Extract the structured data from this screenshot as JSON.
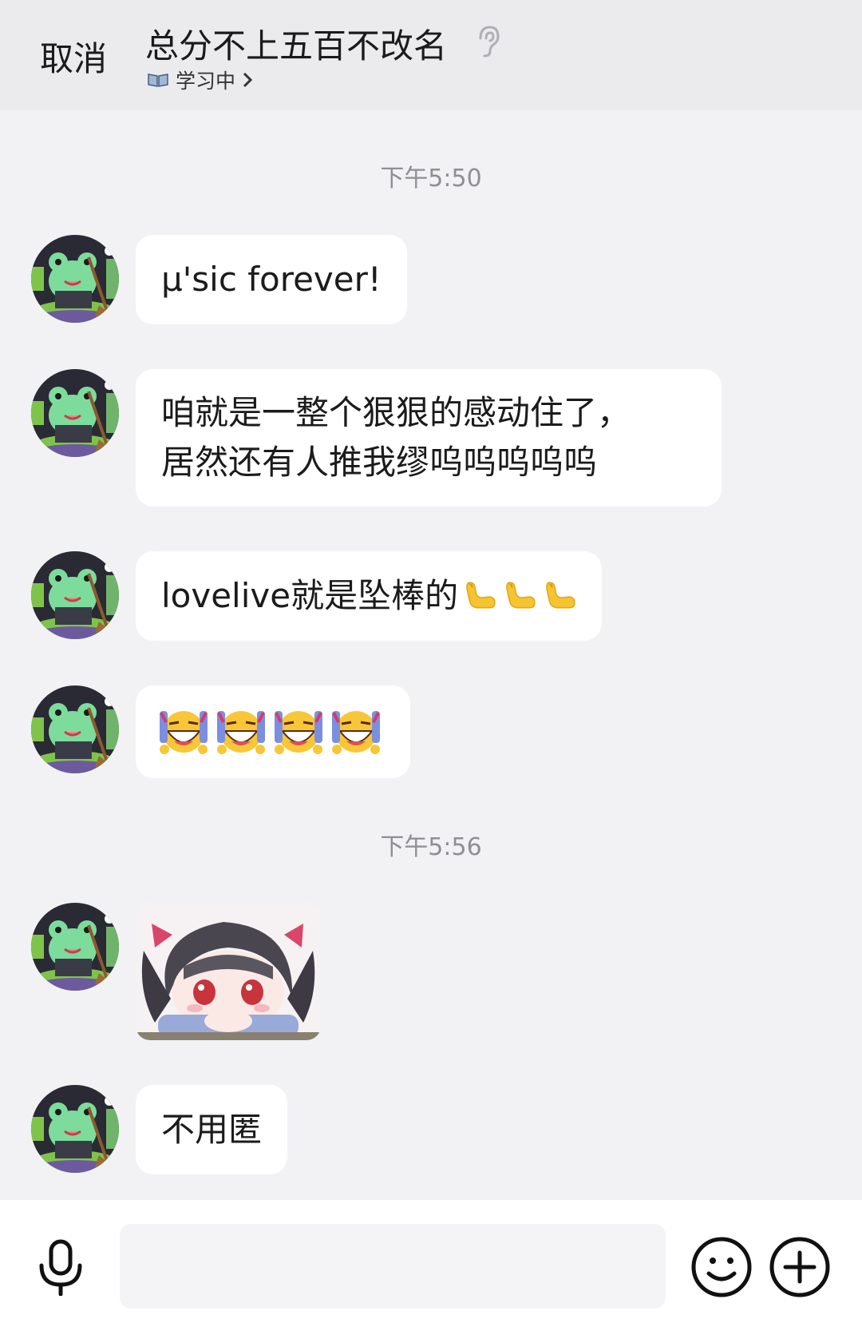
{
  "header": {
    "cancel_label": "取消",
    "title": "总分不上五百不改名",
    "status": "学习中"
  },
  "timestamps": [
    "下午5:50",
    "下午5:56"
  ],
  "messages": [
    {
      "type": "text",
      "text": "μ'sic forever!"
    },
    {
      "type": "text",
      "lines": [
        "咱就是一整个狠狠的感动住了，",
        "居然还有人推我缪呜呜呜呜呜"
      ]
    },
    {
      "type": "text",
      "text": "lovelive就是坠棒的",
      "emoji": "flexed-biceps",
      "emoji_count": 3
    },
    {
      "type": "emoji",
      "emoji": "rolling-laughing",
      "emoji_count": 4
    },
    {
      "type": "sticker",
      "description_icon": "anime-girl-sticker"
    },
    {
      "type": "text",
      "text": "不用匿"
    }
  ],
  "input": {
    "placeholder": "",
    "value": ""
  },
  "icons": {
    "ear": "ear-icon",
    "book": "book-icon",
    "mic": "microphone-icon",
    "smile": "smiley-icon",
    "plus": "plus-circle-icon"
  },
  "colors": {
    "header_bg": "#ebeaed",
    "chat_bg": "#f2f1f4",
    "bubble_bg": "#ffffff",
    "timestamp": "#8f8f93"
  }
}
